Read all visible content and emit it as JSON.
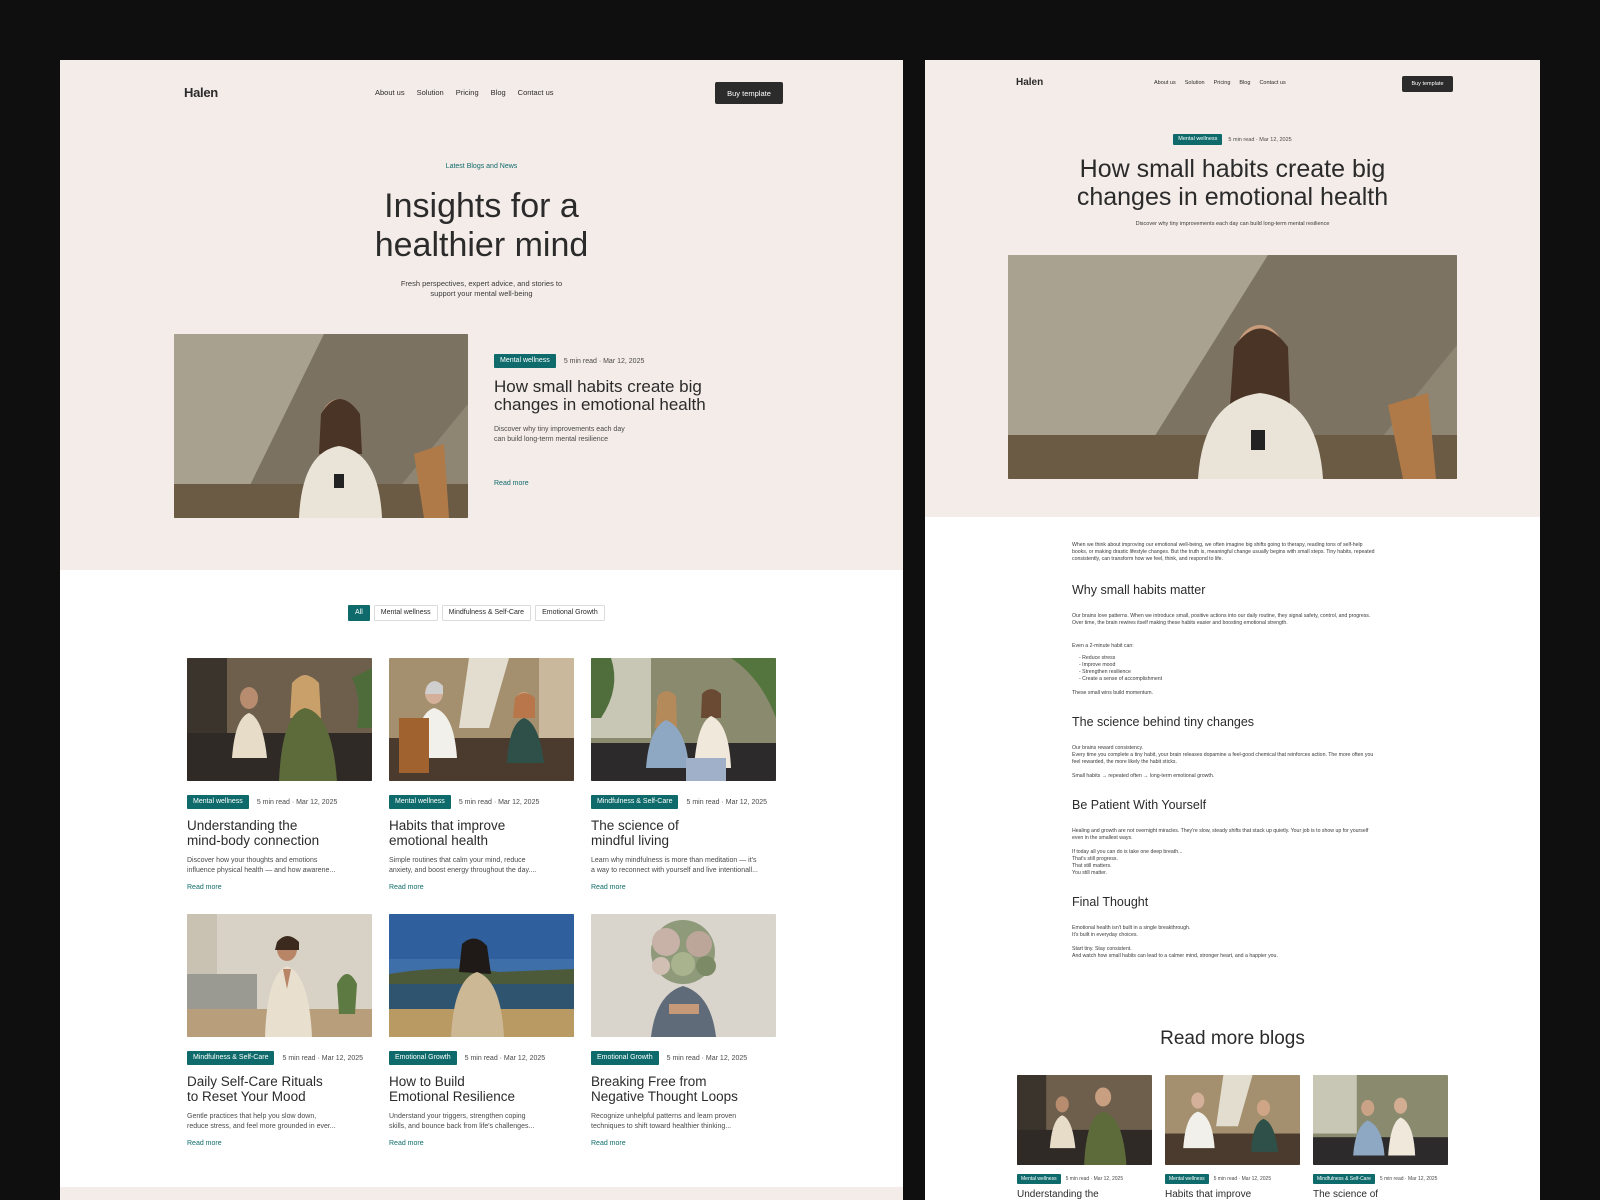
{
  "colors": {
    "accent": "#0f6b6b",
    "cream": "#f4ece8",
    "dark": "#2b2b2b",
    "background": "#0f0f0f"
  },
  "left": {
    "logo": "Halen",
    "nav": [
      "About us",
      "Solution",
      "Pricing",
      "Blog",
      "Contact us"
    ],
    "cta": "Buy template",
    "eyebrow": "Latest Blogs and News",
    "hero_title_1": "Insights for a",
    "hero_title_2": "healthier mind",
    "hero_sub_1": "Fresh perspectives, expert advice, and stories to",
    "hero_sub_2": "support your mental well-being",
    "featured": {
      "tag": "Mental wellness",
      "meta": "5 min read · Mar 12, 2025",
      "title_1": "How small habits create big",
      "title_2": "changes in emotional health",
      "desc_1": "Discover why tiny improvements each day",
      "desc_2": "can build long-term mental resilience",
      "read_more": "Read more"
    },
    "filters": [
      "All",
      "Mental wellness",
      "Mindfulness & Self-Care",
      "Emotional Growth"
    ],
    "cards": [
      {
        "tag": "Mental wellness",
        "meta": "5 min read · Mar 12, 2025",
        "title_1": "Understanding the",
        "title_2": "mind-body connection",
        "desc_1": "Discover how your thoughts and emotions",
        "desc_2": "influence physical health — and how awarene...",
        "read_more": "Read more"
      },
      {
        "tag": "Mental wellness",
        "meta": "5 min read · Mar 12, 2025",
        "title_1": "Habits that improve",
        "title_2": "emotional health",
        "desc_1": "Simple routines that calm your mind, reduce",
        "desc_2": "anxiety, and boost energy throughout the day....",
        "read_more": "Read more"
      },
      {
        "tag": "Mindfulness & Self-Care",
        "meta": "5 min read · Mar 12, 2025",
        "title_1": "The science of",
        "title_2": "mindful living",
        "desc_1": "Learn why mindfulness is more than meditation — it's",
        "desc_2": "a way to reconnect with yourself and live intentionall...",
        "read_more": "Read more"
      },
      {
        "tag": "Mindfulness & Self-Care",
        "meta": "5 min read · Mar 12, 2025",
        "title_1": "Daily Self-Care Rituals",
        "title_2": "to Reset Your Mood",
        "desc_1": "Gentle practices that help you slow down,",
        "desc_2": "reduce stress, and feel more grounded in ever...",
        "read_more": "Read more"
      },
      {
        "tag": "Emotional Growth",
        "meta": "5 min read · Mar 12, 2025",
        "title_1": "How to Build",
        "title_2": "Emotional Resilience",
        "desc_1": "Understand your triggers, strengthen coping",
        "desc_2": "skills, and bounce back from life's challenges...",
        "read_more": "Read more"
      },
      {
        "tag": "Emotional Growth",
        "meta": "5 min read · Mar 12, 2025",
        "title_1": "Breaking Free from",
        "title_2": "Negative Thought Loops",
        "desc_1": "Recognize unhelpful patterns and learn proven",
        "desc_2": "techniques to shift toward healthier thinking...",
        "read_more": "Read more"
      }
    ]
  },
  "right": {
    "logo": "Halen",
    "nav": [
      "About us",
      "Solution",
      "Pricing",
      "Blog",
      "Contact us"
    ],
    "cta": "Buy template",
    "tag": "Mental wellness",
    "meta": "5 min read · Mar 12, 2025",
    "title_1": "How small habits create big",
    "title_2": "changes in emotional health",
    "subtitle": "Discover why tiny improvements each day can build long-term mental resilience",
    "intro": [
      "When we think about improving our emotional well-being, we often imagine big shifts going to therapy, reading tons of self-help",
      "books, or making drastic lifestyle changes. But the truth is, meaningful change usually begins with small steps. Tiny habits, repeated",
      "consistently, can transform how we feel, think, and respond to life."
    ],
    "h_why": "Why small habits matter",
    "why_p": [
      "Our brains love patterns. When we introduce small, positive actions into our daily routine, they signal safety, control, and progress.",
      "Over time, the brain rewires itself making these habits easier and boosting emotional strength."
    ],
    "habit_intro": "Even a 2-minute habit can:",
    "habit_list": [
      "Reduce stress",
      "Improve mood",
      "Strengthen resilience",
      "Create a sense of accomplishment"
    ],
    "habit_outro": "These small wins build momentum.",
    "h_science": "The science behind tiny changes",
    "science_p": [
      "Our brains reward consistency.",
      "Every time you complete a tiny habit, your brain releases dopamine a feel-good chemical that reinforces action. The more often you",
      "feel rewarded, the more likely the habit sticks."
    ],
    "science_formula": "Small habits → repeated often → long-term emotional growth.",
    "h_patient": "Be Patient With Yourself",
    "patient_p": [
      "Healing and growth are not overnight miracles. They're slow, steady shifts that stack up quietly. Your job is to show up for yourself",
      "even in the smallest ways."
    ],
    "patient_lines": [
      "If today all you can do is take one deep breath...",
      "That's still progress.",
      "That still matters.",
      "You still matter."
    ],
    "h_final": "Final Thought",
    "final_lines_a": [
      "Emotional health isn't built in a single breakthrough.",
      "It's built in everyday choices."
    ],
    "final_lines_b": [
      "Start tiny. Stay consistent.",
      "And watch how small habits can lead to a calmer mind, stronger heart, and a happier you."
    ],
    "read_more_title": "Read more blogs",
    "mini_cards": [
      {
        "tag": "Mental wellness",
        "meta": "5 min read · Mar 12, 2025",
        "title": "Understanding the"
      },
      {
        "tag": "Mental wellness",
        "meta": "5 min read · Mar 12, 2025",
        "title": "Habits that improve"
      },
      {
        "tag": "Mindfulness & Self-Care",
        "meta": "5 min read · Mar 12, 2025",
        "title": "The science of"
      }
    ]
  }
}
